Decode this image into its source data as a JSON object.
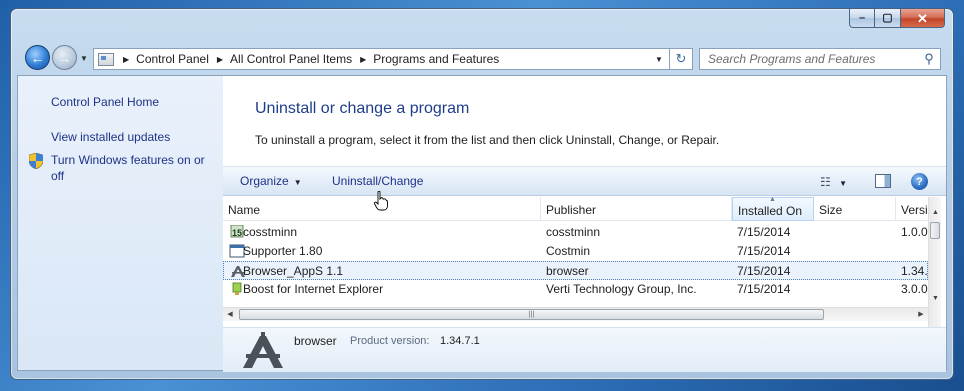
{
  "window": {
    "minimize_glyph": "–",
    "maximize_glyph": "▢",
    "close_glyph": "✕"
  },
  "nav": {
    "breadcrumbs": [
      "Control Panel",
      "All Control Panel Items",
      "Programs and Features"
    ],
    "search_placeholder": "Search Programs and Features"
  },
  "left_pane": {
    "home": "Control Panel Home",
    "view_updates": "View installed updates",
    "windows_features": "Turn Windows features on or off"
  },
  "main": {
    "title": "Uninstall or change a program",
    "description": "To uninstall a program, select it from the list and then click Uninstall, Change, or Repair."
  },
  "toolbar": {
    "organize": "Organize",
    "uninstall_change": "Uninstall/Change",
    "help": "?"
  },
  "columns": [
    "Name",
    "Publisher",
    "Installed On",
    "Size",
    "Versi"
  ],
  "programs": [
    {
      "name": "cosstminn",
      "publisher": "cosstminn",
      "installed": "7/15/2014",
      "size": "",
      "version": "1.0.0."
    },
    {
      "name": "Supporter 1.80",
      "publisher": "Costmin",
      "installed": "7/15/2014",
      "size": "",
      "version": ""
    },
    {
      "name": "Browser_AppS 1.1",
      "publisher": "browser",
      "installed": "7/15/2014",
      "size": "",
      "version": "1.34."
    },
    {
      "name": "Boost for Internet Explorer",
      "publisher": "Verti Technology Group, Inc.",
      "installed": "7/15/2014",
      "size": "",
      "version": "3.0.0."
    }
  ],
  "details": {
    "name": "browser",
    "version_label": "Product version:",
    "version": "1.34.7.1"
  },
  "colors": {
    "accent_title": "#1e3e8c",
    "link": "#1e3287"
  }
}
